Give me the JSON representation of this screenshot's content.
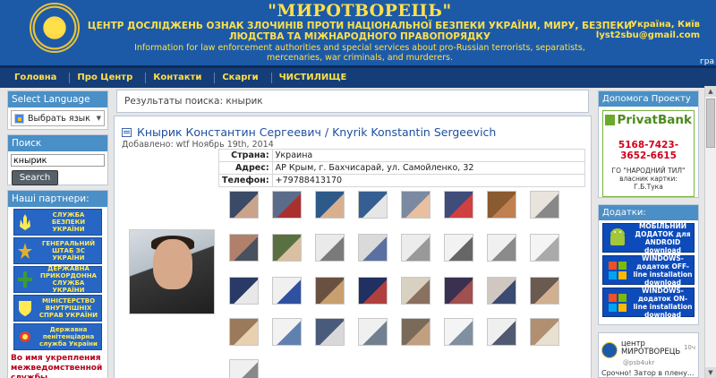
{
  "header": {
    "title": "\"МИРОТВОРЕЦЬ\"",
    "subtitle": "ЦЕНТР ДОСЛІДЖЕНЬ ОЗНАК ЗЛОЧИНІВ ПРОТИ НАЦІОНАЛЬНОЇ БЕЗПЕКИ УКРАЇНИ, МИРУ, БЕЗПЕКИ ЛЮДСТВА ТА МІЖНАРОДНОГО ПРАВОПОРЯДКУ",
    "description": "Information for law enforcement authorities and special services about pro-Russian terrorists, separatists, mercenaries, war criminals, and murderers.",
    "location": "Україна, Київ",
    "email": "lyst2sbu@gmail.com",
    "overflow_text": "гра"
  },
  "nav": {
    "items": [
      "Головна",
      "Про Центр",
      "Контакти",
      "Скарги",
      "ЧИСТИЛИЩЕ"
    ]
  },
  "sidebar_left": {
    "lang_title": "Select Language",
    "lang_select": "Выбрать язык",
    "search_title": "Поиск",
    "search_value": "кнырик",
    "search_button": "Search",
    "partners_title": "Наші партнери:",
    "partners": [
      "СЛУЖБА БЕЗПЕКИ УКРАЇНИ",
      "ГЕНЕРАЛЬНИЙ ШТАБ ЗС УКРАЇНИ",
      "ДЕРЖАВНА ПРИКОРДОННА СЛУЖБА УКРАЇНИ",
      "МІНІСТЕРСТВО ВНУТРІШНІХ СПРАВ УКРАЇНИ",
      "Державна пенітенціарна служба України"
    ],
    "partners_note": "Во имя укрепления межведомственной службы"
  },
  "results_bar": "Результаты поиска: кнырик",
  "entry": {
    "title": "Кнырик Константин Сергеевич / Knyrik Konstantin Sergeevich",
    "added": "Добавлено: wtf Ноябрь 19th, 2014",
    "fields": [
      {
        "key": "Страна:",
        "value": "Украина"
      },
      {
        "key": "Адрес:",
        "value": "АР Крым, г. Бахчисарай, ул. Самойленко, 32"
      },
      {
        "key": "Телефон:",
        "value": "+79788413170"
      }
    ]
  },
  "sidebar_right": {
    "help_title": "Допомога Проекту",
    "bank_name": "PrivatBank",
    "card_number": "5168-7423-3652-6615",
    "holder": "ГО \"НАРОДНИЙ ТИЛ\" власник картки: Г.Б.Тука",
    "addons_title": "Додатки:",
    "downloads": [
      "МОБІЛЬНИЙ ДОДАТОК для ANDROID download",
      "WINDOWS-додаток OFF-line installation download",
      "WINDOWS-додаток ON-line installation download"
    ],
    "twitter_name": "центр МИРОТВОРЕЦЬ",
    "twitter_handle": "@psb4ukr",
    "twitter_time": "10ч",
    "twitter_text": "Срочно! Затор в плену..."
  },
  "colors": {
    "header_bg": "#1c5aa8",
    "nav_bg": "#153e78",
    "accent_yellow": "#ffe04a",
    "box_header": "#4a8fc6",
    "link_blue": "#1d4fa0"
  }
}
